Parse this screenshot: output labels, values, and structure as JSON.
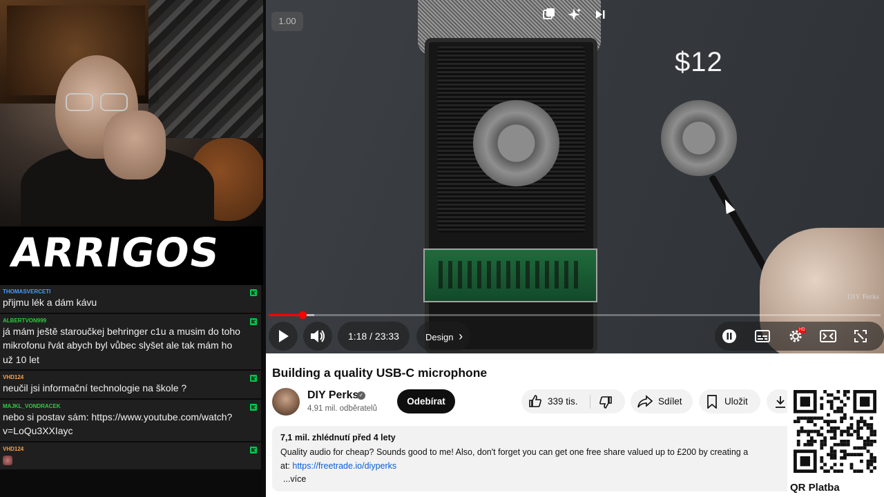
{
  "stream": {
    "logo_text": "ARRIGOS"
  },
  "chat": {
    "messages": [
      {
        "user": "THOMASVERCETI",
        "user_color": "#4a9cff",
        "text": "přijmu lék a dám kávu"
      },
      {
        "user": "ALBERTVON999",
        "user_color": "#2ecc40",
        "text": "já mám ještě staroučkej behringer c1u a musim do toho mikrofonu řvát abych byl vůbec slyšet ale tak mám ho už 10 let"
      },
      {
        "user": "VHD124",
        "user_color": "#ff9f43",
        "text": "neučil jsi informační technologie na škole ?"
      },
      {
        "user": "MAJKL_VONDRACEK",
        "user_color": "#2ecc40",
        "text": "nebo si postav sám: https://www.youtube.com/watch?v=LoQu3XXIayc"
      },
      {
        "user": "VHD124",
        "user_color": "#ff9f43",
        "text": ""
      }
    ]
  },
  "video": {
    "speed_label": "1.00",
    "overlay_price": "$12",
    "watermark": "DIY Perks",
    "current_time": "1:18",
    "duration": "23:33",
    "time_display": "1:18 / 23:33",
    "chapter": "Design",
    "chapter_chevron": "›",
    "progress_played_fraction": 0.055,
    "progress_buffered_fraction": 0.075,
    "hd_badge": "HD",
    "top_icons": [
      "miniplayer-icon",
      "ai-sparkle-icon",
      "skip-next-icon"
    ],
    "control_icons": [
      "play-icon",
      "volume-icon",
      "pause-autoplay-icon",
      "subtitles-icon",
      "settings-icon",
      "theater-icon",
      "fullscreen-icon"
    ]
  },
  "info": {
    "title": "Building a quality USB-C microphone",
    "channel_name": "DIY Perks",
    "verified_mark": "✓",
    "subscribers": "4,91 mil. odběratelů",
    "subscribe_label": "Odebírat",
    "like_count": "339 tis.",
    "share_label": "Sdílet",
    "save_label": "Uložit",
    "description": {
      "meta": "7,1 mil. zhlédnutí  před 4 lety",
      "line1": "Quality audio for cheap? Sounds good to me! Also, don't forget you can get one free share valued up to £200 by creating a",
      "line2_prefix": "at: ",
      "link": "https://freetrade.io/diyperks",
      "more": "...více"
    }
  },
  "qr": {
    "label": "QR Platba"
  },
  "colors": {
    "youtube_red": "#ff0000",
    "link_blue": "#065fd4",
    "chat_bg": "#1f1f1f"
  }
}
